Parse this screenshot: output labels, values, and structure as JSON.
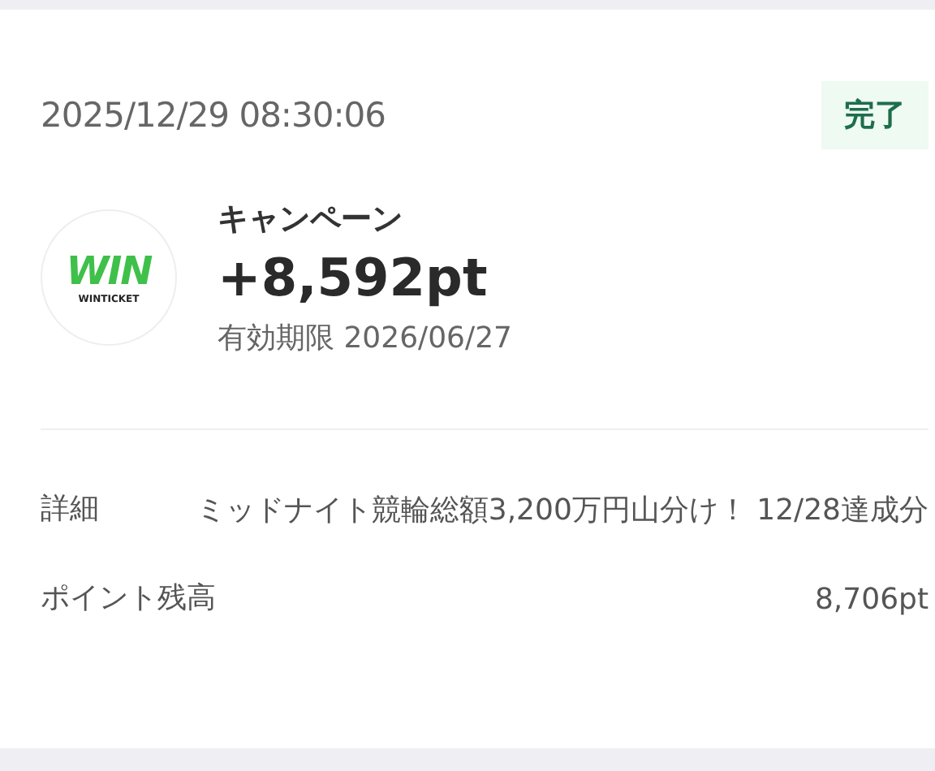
{
  "transaction": {
    "datetime": "2025/12/29 08:30:06",
    "status": {
      "label": "完了",
      "kind": "complete"
    },
    "logo": {
      "mark": "WIN",
      "name": "WINTICKET"
    },
    "category": "キャンペーン",
    "amount": "+8,592pt",
    "expiry": "有効期限 2026/06/27"
  },
  "details": [
    {
      "label": "詳細",
      "value": "ミッドナイト競輪総額3,200万円山分け！ 12/28達成分"
    },
    {
      "label": "ポイント残高",
      "value": "8,706pt"
    }
  ]
}
